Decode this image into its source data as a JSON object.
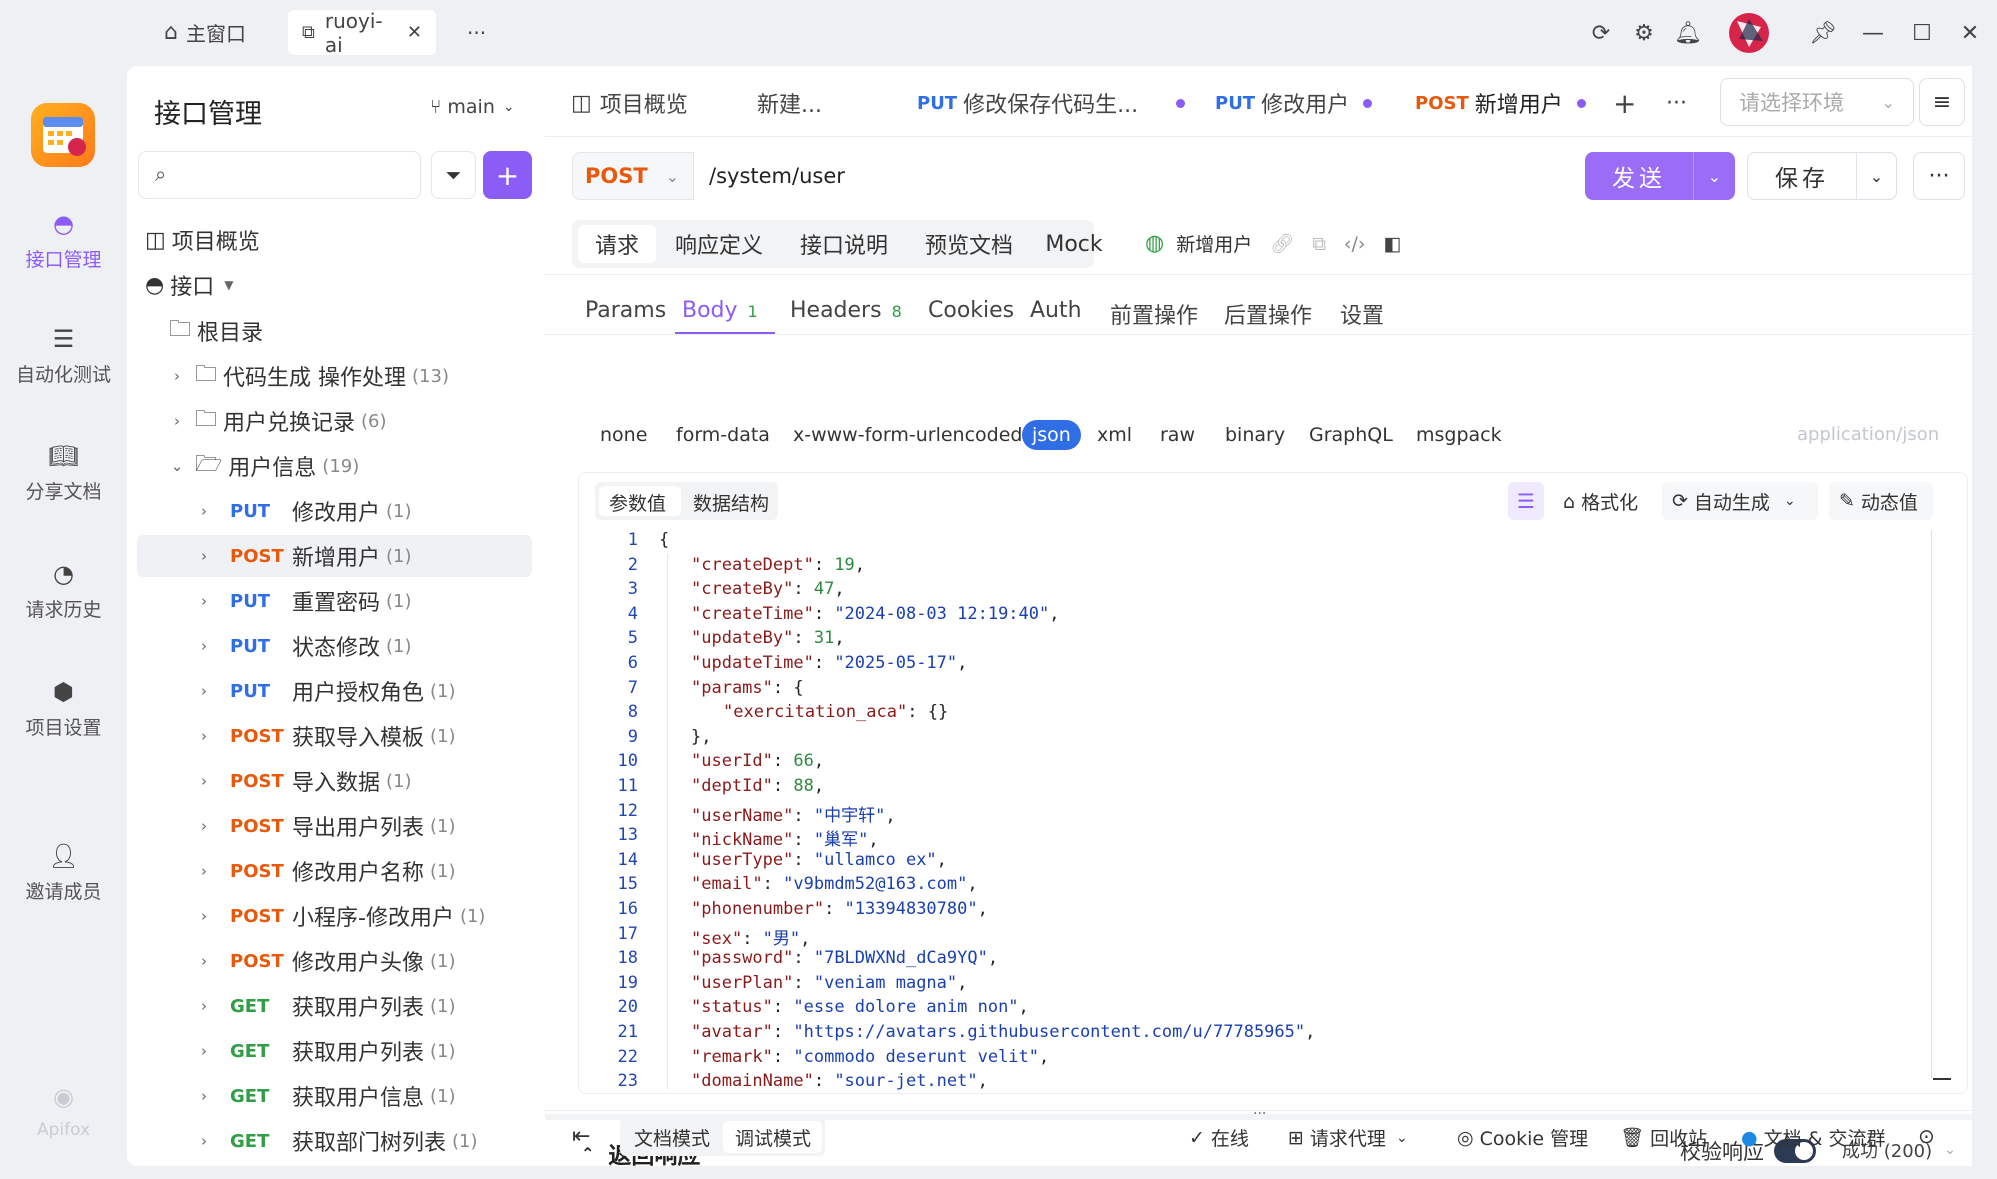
{
  "top": {
    "home_tab": "主窗口",
    "project_tab": "ruoyi-ai",
    "more": "···"
  },
  "rail": {
    "items": [
      {
        "label": "接口管理"
      },
      {
        "label": "自动化测试"
      },
      {
        "label": "分享文档"
      },
      {
        "label": "请求历史"
      },
      {
        "label": "项目设置"
      },
      {
        "label": "邀请成员"
      }
    ],
    "brand": "Apifox"
  },
  "tree": {
    "title": "接口管理",
    "branch": "main",
    "overview": "项目概览",
    "api_root": "接口",
    "root_dir": "根目录",
    "folders": [
      {
        "name": "代码生成 操作处理",
        "count": "(13)"
      },
      {
        "name": "用户兑换记录",
        "count": "(6)"
      },
      {
        "name": "用户信息",
        "count": "(19)"
      }
    ],
    "endpoints": [
      {
        "method": "PUT",
        "name": "修改用户",
        "count": "(1)"
      },
      {
        "method": "POST",
        "name": "新增用户",
        "count": "(1)"
      },
      {
        "method": "PUT",
        "name": "重置密码",
        "count": "(1)"
      },
      {
        "method": "PUT",
        "name": "状态修改",
        "count": "(1)"
      },
      {
        "method": "PUT",
        "name": "用户授权角色",
        "count": "(1)"
      },
      {
        "method": "POST",
        "name": "获取导入模板",
        "count": "(1)"
      },
      {
        "method": "POST",
        "name": "导入数据",
        "count": "(1)"
      },
      {
        "method": "POST",
        "name": "导出用户列表",
        "count": "(1)"
      },
      {
        "method": "POST",
        "name": "修改用户名称",
        "count": "(1)"
      },
      {
        "method": "POST",
        "name": "小程序-修改用户",
        "count": "(1)"
      },
      {
        "method": "POST",
        "name": "修改用户头像",
        "count": "(1)"
      },
      {
        "method": "GET",
        "name": "获取用户列表",
        "count": "(1)"
      },
      {
        "method": "GET",
        "name": "获取用户列表",
        "count": "(1)"
      },
      {
        "method": "GET",
        "name": "获取用户信息",
        "count": "(1)"
      },
      {
        "method": "GET",
        "name": "获取部门树列表",
        "count": "(1)"
      }
    ]
  },
  "main": {
    "tabs": [
      {
        "method": "",
        "label": "项目概览"
      },
      {
        "method": "",
        "label": "新建..."
      },
      {
        "method": "PUT",
        "label": "修改保存代码生..."
      },
      {
        "method": "PUT",
        "label": "修改用户"
      },
      {
        "method": "POST",
        "label": "新增用户"
      }
    ],
    "env_placeholder": "请选择环境",
    "request": {
      "method": "POST",
      "url": "/system/user",
      "send": "发送",
      "save": "保存"
    },
    "section_tabs": [
      "请求",
      "响应定义",
      "接口说明",
      "预览文档",
      "Mock"
    ],
    "api_name": "新增用户",
    "sub_tabs": [
      {
        "label": "Params",
        "badge": ""
      },
      {
        "label": "Body",
        "badge": "1"
      },
      {
        "label": "Headers",
        "badge": "8"
      },
      {
        "label": "Cookies",
        "badge": ""
      },
      {
        "label": "Auth",
        "badge": ""
      },
      {
        "label": "前置操作",
        "badge": ""
      },
      {
        "label": "后置操作",
        "badge": ""
      },
      {
        "label": "设置",
        "badge": ""
      }
    ],
    "body_types": [
      "none",
      "form-data",
      "x-www-form-urlencoded",
      "json",
      "xml",
      "raw",
      "binary",
      "GraphQL",
      "msgpack"
    ],
    "content_type": "application/json",
    "editor_tabs": [
      "参数值",
      "数据结构"
    ],
    "editor_actions": {
      "format": "格式化",
      "auto": "自动生成",
      "dynamic": "动态值"
    },
    "code_lines": [
      {
        "n": "1",
        "indent": 0,
        "key": "",
        "val": "",
        "raw": "{"
      },
      {
        "n": "2",
        "indent": 1,
        "key": "\"createDept\"",
        "val": "19",
        "type": "num",
        "tail": ","
      },
      {
        "n": "3",
        "indent": 1,
        "key": "\"createBy\"",
        "val": "47",
        "type": "num",
        "tail": ","
      },
      {
        "n": "4",
        "indent": 1,
        "key": "\"createTime\"",
        "val": "\"2024-08-03 12:19:40\"",
        "type": "str",
        "tail": ","
      },
      {
        "n": "5",
        "indent": 1,
        "key": "\"updateBy\"",
        "val": "31",
        "type": "num",
        "tail": ","
      },
      {
        "n": "6",
        "indent": 1,
        "key": "\"updateTime\"",
        "val": "\"2025-05-17\"",
        "type": "str",
        "tail": ","
      },
      {
        "n": "7",
        "indent": 1,
        "key": "\"params\"",
        "val": "{",
        "type": "punc",
        "tail": ""
      },
      {
        "n": "8",
        "indent": 2,
        "key": "\"exercitation_aca\"",
        "val": "{}",
        "type": "punc",
        "tail": ""
      },
      {
        "n": "9",
        "indent": 1,
        "key": "",
        "val": "",
        "raw": "},"
      },
      {
        "n": "10",
        "indent": 1,
        "key": "\"userId\"",
        "val": "66",
        "type": "num",
        "tail": ","
      },
      {
        "n": "11",
        "indent": 1,
        "key": "\"deptId\"",
        "val": "88",
        "type": "num",
        "tail": ","
      },
      {
        "n": "12",
        "indent": 1,
        "key": "\"userName\"",
        "val": "\"中宇轩\"",
        "type": "str",
        "tail": ","
      },
      {
        "n": "13",
        "indent": 1,
        "key": "\"nickName\"",
        "val": "\"巢军\"",
        "type": "str",
        "tail": ","
      },
      {
        "n": "14",
        "indent": 1,
        "key": "\"userType\"",
        "val": "\"ullamco ex\"",
        "type": "str",
        "tail": ","
      },
      {
        "n": "15",
        "indent": 1,
        "key": "\"email\"",
        "val": "\"v9bmdm52@163.com\"",
        "type": "str",
        "tail": ","
      },
      {
        "n": "16",
        "indent": 1,
        "key": "\"phonenumber\"",
        "val": "\"13394830780\"",
        "type": "str",
        "tail": ","
      },
      {
        "n": "17",
        "indent": 1,
        "key": "\"sex\"",
        "val": "\"男\"",
        "type": "str",
        "tail": ","
      },
      {
        "n": "18",
        "indent": 1,
        "key": "\"password\"",
        "val": "\"7BLDWXNd_dCa9YQ\"",
        "type": "str",
        "tail": ","
      },
      {
        "n": "19",
        "indent": 1,
        "key": "\"userPlan\"",
        "val": "\"veniam magna\"",
        "type": "str",
        "tail": ","
      },
      {
        "n": "20",
        "indent": 1,
        "key": "\"status\"",
        "val": "\"esse dolore anim non\"",
        "type": "str",
        "tail": ","
      },
      {
        "n": "21",
        "indent": 1,
        "key": "\"avatar\"",
        "val": "\"https://avatars.githubusercontent.com/u/77785965\"",
        "type": "str",
        "tail": ","
      },
      {
        "n": "22",
        "indent": 1,
        "key": "\"remark\"",
        "val": "\"commodo deserunt velit\"",
        "type": "str",
        "tail": ","
      },
      {
        "n": "23",
        "indent": 1,
        "key": "\"domainName\"",
        "val": "\"sour-jet.net\"",
        "type": "str",
        "tail": ","
      }
    ],
    "response": {
      "title": "返回响应",
      "validate": "校验响应",
      "status": "成功 (200)"
    },
    "footer": {
      "doc_mode": "文档模式",
      "debug_mode": "调试模式",
      "online": "在线",
      "proxy": "请求代理",
      "cookie": "Cookie 管理",
      "trash": "回收站",
      "community": "文档 & 交流群"
    }
  },
  "colors": {
    "accent": "#8b5cf6",
    "put": "#2f6ee5",
    "post": "#e8590c",
    "get": "#2f9e44"
  }
}
